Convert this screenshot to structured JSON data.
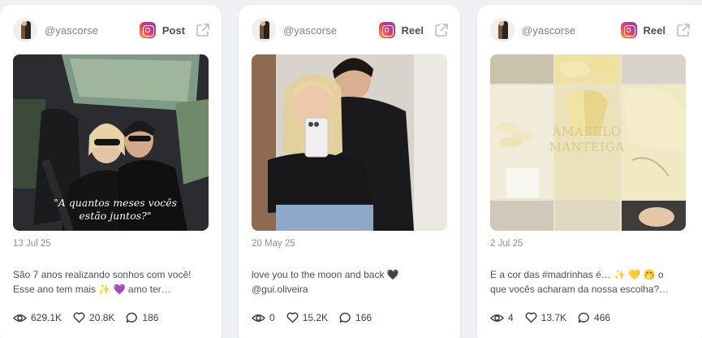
{
  "posts": [
    {
      "handle": "@yascorse",
      "type": "Post",
      "date": "13 Jul 25",
      "caption_line1": "São 7 anos realizando sonhos com você!",
      "caption_line2": "Esse ano tem mais ✨ 💜 amo ter…",
      "photo_overlay_text": "\"A quantos meses vocês estão juntos?\"",
      "views": "629.1K",
      "likes": "20.8K",
      "comments": "186"
    },
    {
      "handle": "@yascorse",
      "type": "Reel",
      "date": "20 May 25",
      "caption_line1": "love you to the moon and back 🖤",
      "caption_line2": "@gui.oliveira",
      "views": "0",
      "likes": "15.2K",
      "comments": "166"
    },
    {
      "handle": "@yascorse",
      "type": "Reel",
      "date": "2 Jul 25",
      "caption_line1": "E a cor das #madrinhas é… ✨ 💛 🤭 o",
      "caption_line2": "que vocês acharam da nossa escolha?…",
      "photo_overlay_text": "AMARELO MANTEIGA",
      "views": "4",
      "likes": "13.7K",
      "comments": "466"
    }
  ],
  "icons": {
    "platform": "instagram-icon",
    "external": "external-link-icon",
    "views": "eye-icon",
    "likes": "heart-icon",
    "comments": "comment-icon"
  },
  "colors": {
    "background": "#eef0f4",
    "card": "#ffffff",
    "muted_text": "#8b909c",
    "body_text": "#4a4f5c"
  }
}
